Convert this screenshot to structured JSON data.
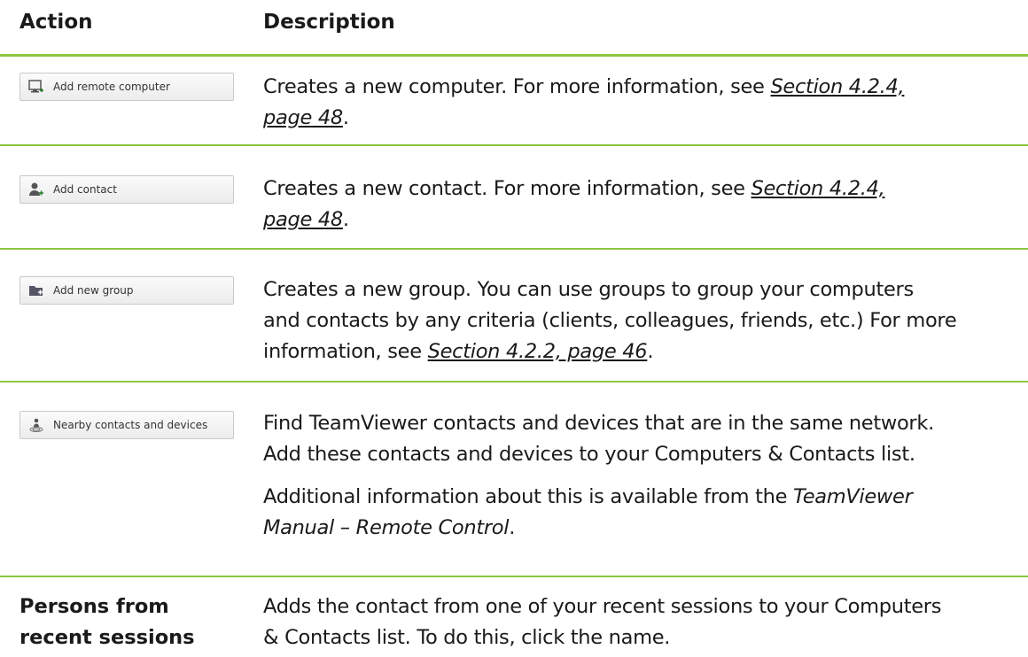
{
  "header": {
    "action": "Action",
    "description": "Description"
  },
  "rows": [
    {
      "button_label": "Add remote computer",
      "icon": "monitor-add-icon",
      "text_pre": "Creates a new computer. For more information, see ",
      "ref_line1": "Section 4.2.4,",
      "ref_line2": "page 48",
      "text_post": "."
    },
    {
      "button_label": "Add contact",
      "icon": "person-add-icon",
      "text_pre": "Creates a new contact. For more information, see ",
      "ref_line1": "Section 4.2.4,",
      "ref_line2": "page 48",
      "text_post": "."
    },
    {
      "button_label": "Add new group",
      "icon": "folder-add-icon",
      "line1": "Creates a new group. You can use groups to group your computers",
      "line2": "and contacts by any criteria (clients, colleagues, friends, etc.) For more",
      "line3_pre": "information, see ",
      "ref": "Section 4.2.2, page 46",
      "text_post": "."
    },
    {
      "button_label": "Nearby contacts and devices",
      "icon": "nearby-devices-icon",
      "line1": "Find TeamViewer contacts and devices that are in the same network.",
      "line2": "Add these contacts and devices to your Computers & Contacts list.",
      "p2_pre": "Additional information about this is available from the ",
      "p2_italic_line1": "TeamViewer",
      "p2_italic_line2": "Manual – Remote Control",
      "p2_post": "."
    },
    {
      "label_line1": "Persons from",
      "label_line2": "recent sessions",
      "line1": "Adds the contact from one of your recent sessions to your Computers",
      "line2": "& Contacts list. To do this, click the name."
    }
  ]
}
